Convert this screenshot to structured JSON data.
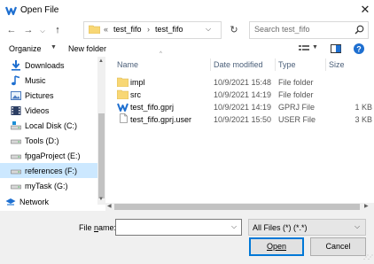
{
  "window": {
    "title": "Open File",
    "close_glyph": "✕"
  },
  "nav": {
    "back": "←",
    "forward": "→",
    "up": "↑"
  },
  "address": {
    "prefix": "«",
    "crumbs": [
      "test_fifo",
      "test_fifo"
    ],
    "separator": "›",
    "dropdown": "⌵",
    "refresh": "↻"
  },
  "search": {
    "placeholder": "Search test_fifo"
  },
  "toolbar": {
    "organize": "Organize",
    "new_folder": "New folder",
    "caret": "▼"
  },
  "sidebar": {
    "items": [
      {
        "label": "Downloads",
        "icon": "download-arrow-icon"
      },
      {
        "label": "Music",
        "icon": "music-note-icon"
      },
      {
        "label": "Pictures",
        "icon": "pictures-icon"
      },
      {
        "label": "Videos",
        "icon": "videos-icon"
      },
      {
        "label": "Local Disk (C:)",
        "icon": "drive-icon"
      },
      {
        "label": "Tools (D:)",
        "icon": "drive-icon"
      },
      {
        "label": "fpgaProject (E:)",
        "icon": "drive-icon"
      },
      {
        "label": "references (F:)",
        "icon": "drive-icon",
        "selected": true
      },
      {
        "label": "myTask (G:)",
        "icon": "drive-icon"
      },
      {
        "label": "Network",
        "icon": "network-icon"
      }
    ]
  },
  "columns": {
    "name": "Name",
    "date": "Date modified",
    "type": "Type",
    "size": "Size"
  },
  "files": [
    {
      "name": "impl",
      "date": "10/9/2021 15:48",
      "type": "File folder",
      "size": "",
      "icon": "folder-icon"
    },
    {
      "name": "src",
      "date": "10/9/2021 14:19",
      "type": "File folder",
      "size": "",
      "icon": "folder-icon"
    },
    {
      "name": "test_fifo.gprj",
      "date": "10/9/2021 14:19",
      "type": "GPRJ File",
      "size": "1 KB",
      "icon": "gprj-icon"
    },
    {
      "name": "test_fifo.gprj.user",
      "date": "10/9/2021 15:50",
      "type": "USER File",
      "size": "3 KB",
      "icon": "document-icon"
    }
  ],
  "bottom": {
    "file_name_prefix": "File ",
    "file_name_mnemonic": "n",
    "file_name_suffix": "ame:",
    "file_name_value": "",
    "filter": "All Files (*) (*.*)",
    "open_label": "Open",
    "cancel_label": "Cancel"
  },
  "colors": {
    "accent": "#0078d7",
    "folder": "#f8d775",
    "selection": "#cce8ff"
  }
}
